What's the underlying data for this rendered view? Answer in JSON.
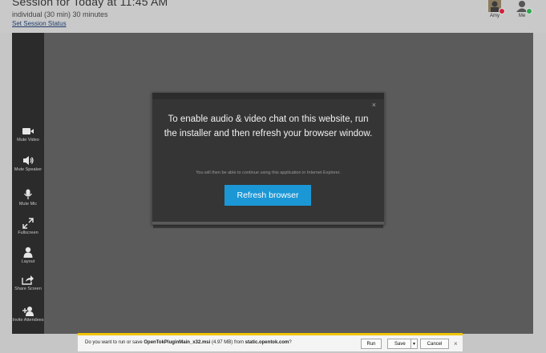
{
  "header": {
    "title": "Session for Today at 11:45 AM",
    "subtitle": "individual (30 min) 30 minutes",
    "status_link": "Set Session Status"
  },
  "participants": [
    {
      "name": "Amy",
      "status_color": "#d21f3c"
    },
    {
      "name": "Me",
      "status_color": "#2fa84f"
    }
  ],
  "toolbar": {
    "items": [
      {
        "label": "Mute Video",
        "icon": "video-camera-icon"
      },
      {
        "label": "Mute Speaker",
        "icon": "speaker-icon"
      },
      {
        "label": "Mute Mic",
        "icon": "microphone-icon"
      },
      {
        "label": "Fullscreen",
        "icon": "fullscreen-icon"
      },
      {
        "label": "Layout",
        "icon": "person-icon"
      },
      {
        "label": "Share Screen",
        "icon": "share-icon"
      },
      {
        "label": "Invite Attendees",
        "icon": "add-person-icon"
      }
    ]
  },
  "dialog": {
    "message": "To enable audio & video chat on this website, run the installer and then refresh your browser window.",
    "note": "You will then be able to continue using this application in Internet Explorer.",
    "button": "Refresh browser",
    "close_glyph": "×",
    "accent_color": "#1b97d6"
  },
  "download_bar": {
    "prompt_start": "Do you want to run or save ",
    "file_name": "OpenTokPluginMain_x32.msi",
    "size_text": " (4.97 MB) from ",
    "source": "static.opentok.com",
    "prompt_end": "?",
    "run_label": "Run",
    "save_label": "Save",
    "cancel_label": "Cancel",
    "close_glyph": "×"
  }
}
